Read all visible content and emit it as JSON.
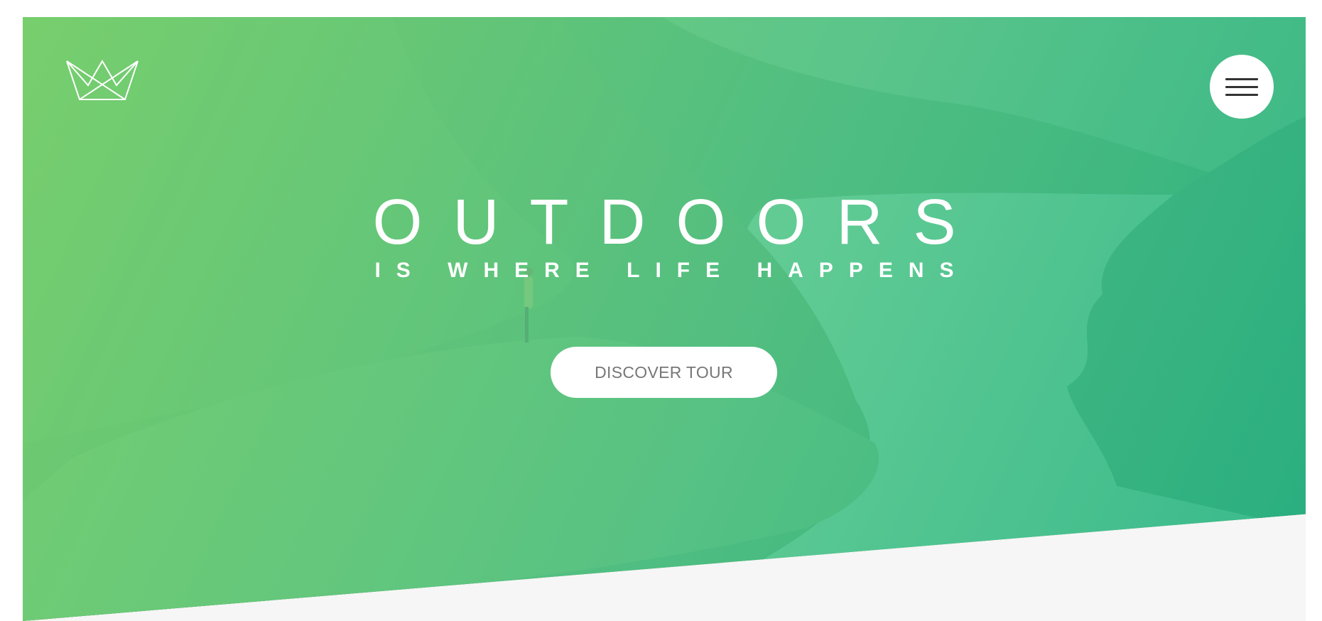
{
  "header": {
    "logo_icon": "crown-icon",
    "menu_icon": "hamburger-menu-icon"
  },
  "hero": {
    "title": "OUTDOORS",
    "subtitle": "IS WHERE LIFE HAPPENS",
    "cta_label": "DISCOVER TOUR",
    "gradient_colors": [
      "#7dd56f",
      "#55c88c",
      "#28b485"
    ]
  },
  "colors": {
    "page_background": "#f6f6f6",
    "button_text": "#777777",
    "menu_lines": "#333333"
  }
}
